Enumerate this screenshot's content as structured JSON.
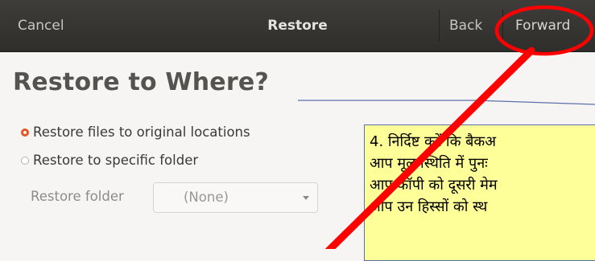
{
  "header": {
    "cancel_label": "Cancel",
    "title": "Restore",
    "back_label": "Back",
    "forward_label": "Forward"
  },
  "main": {
    "title": "Restore to Where?",
    "options": [
      {
        "label": "Restore files to original locations",
        "selected": true
      },
      {
        "label": "Restore to specific folder",
        "selected": false
      }
    ],
    "folder": {
      "label": "Restore folder",
      "value": "(None)"
    }
  },
  "callout": {
    "lines": [
      "4. निर्दिष्ट करें कि बैकअ",
      "आप मूल स्थिति में पुनः",
      "आप कॉपी को दूसरी मेम",
      "आप उन हिस्सों को स्थ"
    ]
  },
  "colors": {
    "header_bg": "#363431",
    "accent": "#e95420",
    "annotation_red": "#ff0000",
    "callout_bg": "#ffff99"
  }
}
